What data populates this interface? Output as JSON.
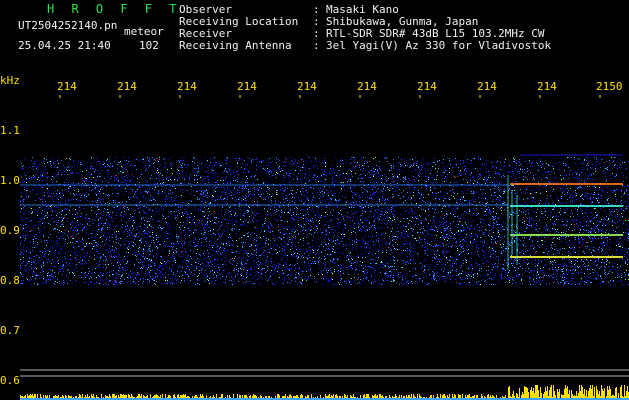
{
  "header": {
    "brand": "H R O F F T",
    "filename": "UT2504252140.pn",
    "mode": "meteor",
    "datetime": "25.04.25 21:40",
    "count": "102",
    "info_labels": [
      "Observer",
      "Receiving Location",
      "Receiver",
      "Receiving Antenna"
    ],
    "info_separator": ":",
    "info_values": [
      "Masaki Kano",
      "Shibukawa, Gunma, Japan",
      "RTL-SDR SDR# 43dB L15 103.2MHz CW",
      "3el Yagi(V) Az 330 for Vladivostok"
    ]
  },
  "axes": {
    "y_unit": "kHz",
    "y_ticks": [
      "1.1",
      "1.0",
      "0.9",
      "0.8",
      "0.7",
      "0.6"
    ],
    "x_ticks": [
      "214",
      "214",
      "214",
      "214",
      "214",
      "214",
      "214",
      "214",
      "214",
      "2150"
    ]
  },
  "colors": {
    "background": "#000000",
    "brand": "#29e34a",
    "axis_text": "#ffe000",
    "header_text": "#f2f2f2",
    "grid": "#b0b0b0",
    "noise_low": "#1a1aff",
    "noise_high": "#ff3030",
    "bottom_bar": "#ffe000"
  }
}
